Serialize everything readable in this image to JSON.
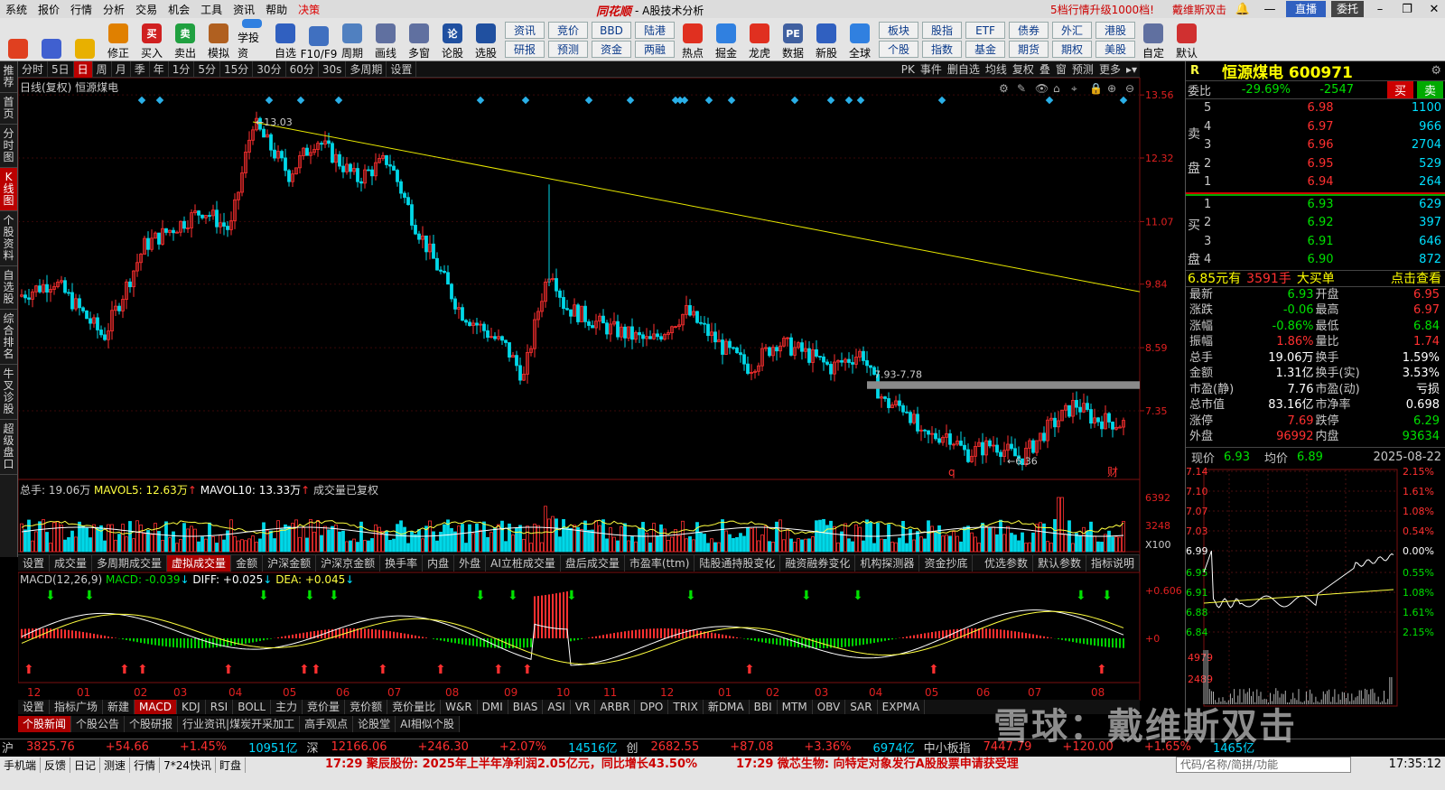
{
  "menubar": {
    "items": [
      "系统",
      "报价",
      "行情",
      "分析",
      "交易",
      "机会",
      "工具",
      "资讯",
      "帮助",
      "决策"
    ],
    "logo": "同花顺",
    "title": "- A股技术分析",
    "promo": "5档行情升级1000档!",
    "user": "戴维斯双击",
    "live": "直播",
    "wt": "委托"
  },
  "toolbar": {
    "left": [
      {
        "l": "",
        "c": "#e04020",
        "n": "home-icon"
      },
      {
        "l": "",
        "c": "#4060d0",
        "n": "robot-icon"
      },
      {
        "l": "",
        "c": "#e8b000",
        "n": "back-arrow-icon"
      },
      {
        "l": "修正",
        "c": "#e08000",
        "n": "fix-icon"
      },
      {
        "l": "买入",
        "c": "#d02020",
        "n": "buy-icon",
        "t": "买"
      },
      {
        "l": "卖出",
        "c": "#20a040",
        "n": "sell-icon",
        "t": "卖"
      },
      {
        "l": "模拟",
        "c": "#b06020",
        "n": "simulate-icon"
      },
      {
        "l": "学投资",
        "c": "#3080e0",
        "n": "learn-icon"
      },
      {
        "l": "自选",
        "c": "#3060c0",
        "n": "star-icon"
      },
      {
        "l": "F10/F9",
        "c": "#4070c0",
        "n": "f10-icon"
      },
      {
        "l": "周期",
        "c": "#5080c0",
        "n": "period-icon"
      },
      {
        "l": "画线",
        "c": "#6070a0",
        "n": "pen-icon"
      },
      {
        "l": "多窗",
        "c": "#6070a0",
        "n": "multiwindow-icon"
      },
      {
        "l": "论股",
        "c": "#2050a0",
        "n": "forum-icon",
        "t": "论"
      },
      {
        "l": "选股",
        "c": "#2050a0",
        "n": "stock-picker-icon"
      }
    ],
    "grid1": [
      "资讯",
      "竞价",
      "BBD",
      "陆港",
      "研报",
      "预测",
      "资金",
      "两融"
    ],
    "mid": [
      {
        "l": "热点",
        "c": "#e03020",
        "n": "hot-icon"
      },
      {
        "l": "掘金",
        "c": "#3080e0",
        "n": "gold-icon"
      },
      {
        "l": "龙虎",
        "c": "#e03020",
        "n": "dragon-icon"
      },
      {
        "l": "数据",
        "c": "#4060a0",
        "n": "data-icon",
        "t": "PE"
      },
      {
        "l": "新股",
        "c": "#3060c0",
        "n": "ipo-icon"
      },
      {
        "l": "全球",
        "c": "#3080e0",
        "n": "globe-icon"
      }
    ],
    "grid2": [
      "板块",
      "股指",
      "ETF",
      "债券",
      "外汇",
      "港股",
      "个股",
      "指数",
      "基金",
      "期货",
      "期权",
      "美股"
    ],
    "right": [
      {
        "l": "自定",
        "c": "#6070a0",
        "n": "custom-icon"
      },
      {
        "l": "默认",
        "c": "#d03030",
        "n": "default-icon"
      }
    ]
  },
  "sidebar": [
    "推荐",
    "首页",
    "分时图",
    "K线图",
    "个股资料",
    "自选股",
    "综合排名",
    "牛叉诊股",
    "超级盘口"
  ],
  "periods": [
    "分时",
    "5日",
    "日",
    "周",
    "月",
    "季",
    "年",
    "1分",
    "5分",
    "15分",
    "30分",
    "60分",
    "30s",
    "多周期",
    "设置"
  ],
  "period_active": "日",
  "periods_right": [
    "PK",
    "事件",
    "删自选",
    "均线",
    "复权",
    "叠",
    "窗",
    "预测",
    "更多"
  ],
  "chart": {
    "legend": "日线(复权) 恒源煤电",
    "high_label": "13.03",
    "low_label": "6.36",
    "gap_label": "7.93-7.78",
    "marker_q": "q",
    "marker_cai": "财",
    "yticks": [
      "13.56",
      "12.32",
      "11.07",
      "9.84",
      "8.59",
      "7.35"
    ],
    "vol_ticks": [
      "6392",
      "3248",
      "X100"
    ],
    "macd_ticks": [
      "+0.606",
      "+0"
    ],
    "xlabels": [
      "12",
      "01",
      "02",
      "03",
      "04",
      "05",
      "06",
      "07",
      "08",
      "09",
      "10",
      "11",
      "12",
      "01",
      "02",
      "03",
      "04",
      "05",
      "06",
      "07",
      "08"
    ]
  },
  "volinfo": {
    "a": "总手: 19.06万",
    "b": "MAVOL5: 12.63万",
    "c": "MAVOL10: 13.33万",
    "d": "成交量已复权"
  },
  "indtabs": [
    "设置",
    "成交量",
    "多周期成交量",
    "虚拟成交量",
    "金额",
    "沪深金额",
    "沪深京金额",
    "换手率",
    "内盘",
    "外盘",
    "AI立桩成交量",
    "盘后成交量",
    "市盈率(ttm)",
    "陆股通持股变化",
    "融资融券变化",
    "机构探测器",
    "资金抄底"
  ],
  "indtab_active": "虚拟成交量",
  "indtabs_right": [
    "优选参数",
    "默认参数",
    "指标说明"
  ],
  "macdinfo": {
    "a": "MACD(12,26,9)",
    "b": "MACD: -0.039",
    "c": "DIFF: +0.025",
    "d": "DEA: +0.045"
  },
  "bottabs": [
    "设置",
    "指标广场",
    "新建",
    "MACD",
    "KDJ",
    "RSI",
    "BOLL",
    "主力",
    "竞价量",
    "竞价额",
    "竞价量比",
    "W&R",
    "DMI",
    "BIAS",
    "ASI",
    "VR",
    "ARBR",
    "DPO",
    "TRIX",
    "新DMA",
    "BBI",
    "MTM",
    "OBV",
    "SAR",
    "EXPMA"
  ],
  "bottab_active": "MACD",
  "newstabs": [
    "个股新闻",
    "个股公告",
    "个股研报",
    "行业资讯|煤炭开采加工",
    "高手观点",
    "论股堂",
    "AI相似个股"
  ],
  "ticker": {
    "sh": [
      "沪",
      "3825.76",
      "+54.66",
      "+1.45%",
      "10951亿"
    ],
    "sz": [
      "深",
      "12166.06",
      "+246.30",
      "+2.07%",
      "14516亿"
    ],
    "cy": [
      "创",
      "2682.55",
      "+87.08",
      "+3.36%",
      "6974亿"
    ],
    "zx": [
      "中小板指",
      "7447.79",
      "+120.00",
      "+1.65%",
      "1465亿"
    ]
  },
  "status": {
    "items": [
      "手机端",
      "反馈",
      "日记",
      "测速",
      "行情",
      "7*24快讯",
      "盯盘"
    ],
    "news1": "17:29 聚辰股份: 2025年上半年净利润2.05亿元，同比增长43.50%",
    "news2": "17:29 微芯生物: 向特定对象发行A股股票申请获受理",
    "search": "代码/名称/简拼/功能",
    "time": "17:35:12"
  },
  "rp": {
    "name": "恒源煤电 600971",
    "wb": [
      "委比",
      "-29.69%",
      "-2547"
    ],
    "buy": "买",
    "sell": "卖",
    "asks": [
      [
        "5",
        "6.98",
        "1100"
      ],
      [
        "4",
        "6.97",
        "966"
      ],
      [
        "3",
        "6.96",
        "2704"
      ],
      [
        "2",
        "6.95",
        "529"
      ],
      [
        "1",
        "6.94",
        "264"
      ]
    ],
    "bids": [
      [
        "1",
        "6.93",
        "629"
      ],
      [
        "2",
        "6.92",
        "397"
      ],
      [
        "3",
        "6.91",
        "646"
      ],
      [
        "4",
        "6.90",
        "872"
      ]
    ],
    "ask_label": "卖盘",
    "bid_label": "买盘",
    "big": [
      "6.85元有",
      "3591手",
      "大买单",
      "点击查看"
    ],
    "stats": [
      [
        "最新",
        "6.93",
        "开盘",
        "6.95"
      ],
      [
        "涨跌",
        "-0.06",
        "最高",
        "6.97"
      ],
      [
        "涨幅",
        "-0.86%",
        "最低",
        "6.84"
      ],
      [
        "振幅",
        "1.86%",
        "量比",
        "1.74"
      ],
      [
        "总手",
        "19.06万",
        "换手",
        "1.59%"
      ],
      [
        "金额",
        "1.31亿",
        "换手(实)",
        "3.53%"
      ],
      [
        "市盈(静)",
        "7.76",
        "市盈(动)",
        "亏损"
      ],
      [
        "总市值",
        "83.16亿",
        "市净率",
        "0.698"
      ],
      [
        "涨停",
        "7.69",
        "跌停",
        "6.29"
      ],
      [
        "外盘",
        "96992",
        "内盘",
        "93634"
      ]
    ],
    "intraday_head": [
      "现价",
      "6.93",
      "均价",
      "6.89",
      "2025-08-22"
    ],
    "intraday_y": [
      "7.14",
      "7.10",
      "7.07",
      "7.03",
      "6.99",
      "6.95",
      "6.91",
      "6.88",
      "6.84"
    ],
    "intraday_pct": [
      "2.15%",
      "1.61%",
      "1.08%",
      "0.54%",
      "0.00%",
      "0.55%",
      "1.08%",
      "1.61%",
      "2.15%"
    ],
    "intraday_vol": [
      "4979",
      "2489"
    ]
  },
  "watermark": "雪球：戴维斯双击"
}
